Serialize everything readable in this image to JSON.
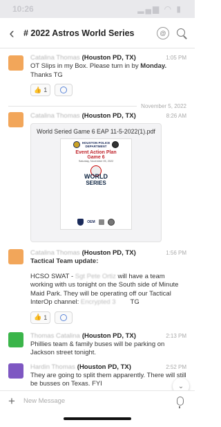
{
  "status_bar": {
    "time": "10:26",
    "icons": "▂▄▆ ◠ ▮"
  },
  "header": {
    "back": "‹",
    "title": "# 2022 Astros World Series",
    "icon1": "@"
  },
  "messages": [
    {
      "avatar_color": "#f2a65a",
      "sender_blur": "Catalina Thomas",
      "sender": "(Houston PD, TX)",
      "time": "1:05 PM",
      "line1": "OT Slips in my Box.   Please turn in by ",
      "bold": "Monday.",
      "line2": "Thanks TG",
      "reaction_count": "1"
    },
    {
      "avatar_color": "#f2a65a",
      "sender_blur": "Catalina Thomas",
      "sender": "(Houston PD, TX)",
      "time": "8:26 AM",
      "file_name": "World Seried Game 6 EAP 11-5-2022(1).pdf",
      "pdf": {
        "dept": "HOUSTON POLICE",
        "dept2": "DEPARTMENT",
        "title": "Event Action Plan",
        "game": "Game 6",
        "date": "Saturday, November 05, 2022",
        "ws1": "WORLD",
        "ws2": "SERIES",
        "oem": "OEM"
      }
    },
    {
      "avatar_color": "#f2a65a",
      "sender_blur": "Catalina Thomas",
      "sender": "(Houston PD, TX)",
      "time": "1:56 PM",
      "heading": "Tactical Team update:",
      "t1": "HCSO SWAT - ",
      "t1_blur": "Sgt Pete Ortiz",
      "t2": " will have a team working with us tonight on the South side of Minute Maid Park. They will be operating off our Tactical InterOp channel: ",
      "t2_blur": "Encrypted 3",
      "t3": "        TG",
      "reaction_count": "1"
    },
    {
      "avatar_color": "#3bb54a",
      "sender_blur": "Thomas Catalina",
      "sender": "(Houston PD, TX)",
      "time": "2:13 PM",
      "text": "Phillies team & family buses will be parking on Jackson street tonight."
    },
    {
      "avatar_color": "#7e57c2",
      "sender_blur": "Hardin Thomas",
      "sender": "(Houston PD, TX)",
      "time": "2:52 PM",
      "text": "They are going to split them apparently. There will still be busses on Texas. FYI",
      "reaction_count": "2"
    }
  ],
  "divider": "November 5, 2022",
  "composer": {
    "plus": "+",
    "placeholder": "New Message"
  },
  "scroll_down": "⌄"
}
